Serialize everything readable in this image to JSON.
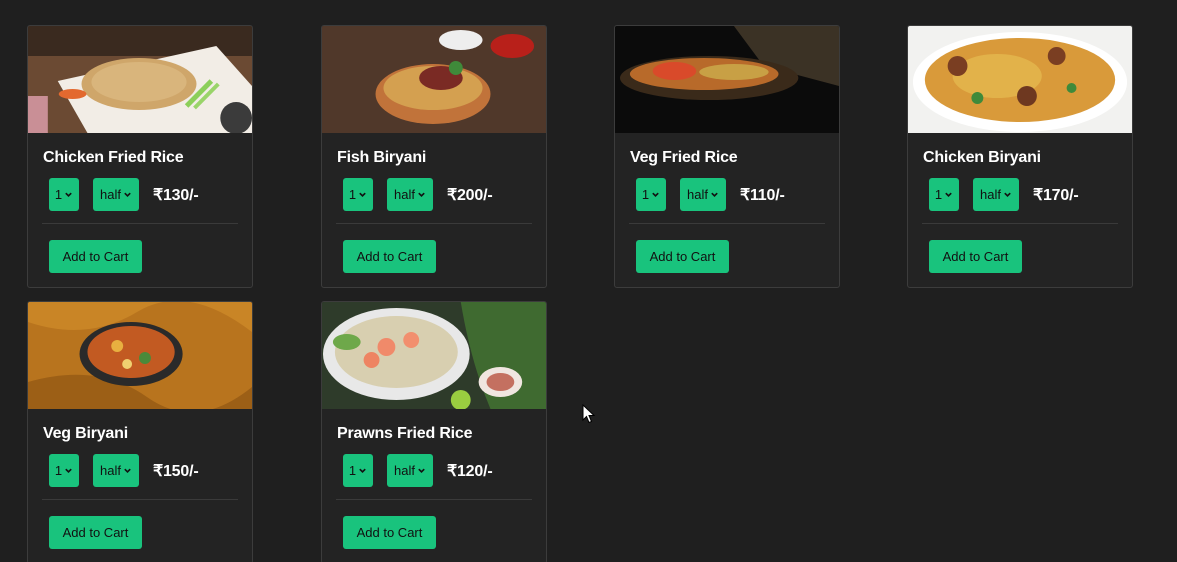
{
  "products": [
    {
      "name": "Chicken Fried Rice",
      "qty": "1",
      "size": "half",
      "price": "₹130/-",
      "button": "Add to Cart",
      "image": "chicken-fried-rice-photo"
    },
    {
      "name": "Fish Biryani",
      "qty": "1",
      "size": "half",
      "price": "₹200/-",
      "button": "Add to Cart",
      "image": "fish-biryani-photo"
    },
    {
      "name": "Veg Fried Rice",
      "qty": "1",
      "size": "half",
      "price": "₹110/-",
      "button": "Add to Cart",
      "image": "veg-fried-rice-photo"
    },
    {
      "name": "Chicken Biryani",
      "qty": "1",
      "size": "half",
      "price": "₹170/-",
      "button": "Add to Cart",
      "image": "chicken-biryani-photo"
    },
    {
      "name": "Veg Biryani",
      "qty": "1",
      "size": "half",
      "price": "₹150/-",
      "button": "Add to Cart",
      "image": "veg-biryani-photo"
    },
    {
      "name": "Prawns Fried Rice",
      "qty": "1",
      "size": "half",
      "price": "₹120/-",
      "button": "Add to Cart",
      "image": "prawns-fried-rice-photo"
    }
  ],
  "colors": {
    "accent": "#19c37d",
    "background": "#1f1f1f",
    "card": "#232323"
  }
}
